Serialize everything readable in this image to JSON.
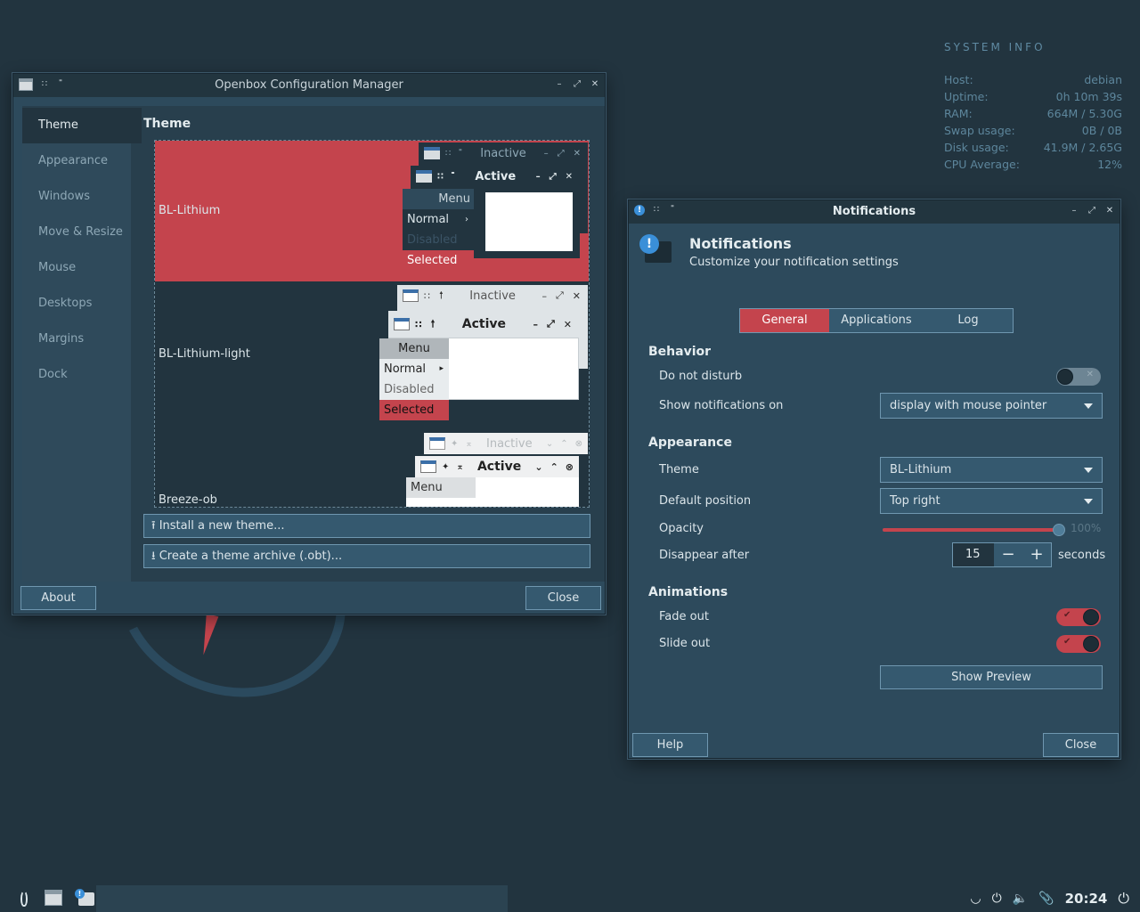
{
  "conky": {
    "title": "SYSTEM INFO",
    "rows": [
      {
        "label": "Host:",
        "value": "debian"
      },
      {
        "label": "Uptime:",
        "value": "0h 10m 39s"
      },
      {
        "label": "RAM:",
        "value": "664M / 5.30G"
      },
      {
        "label": "Swap usage:",
        "value": "0B / 0B"
      },
      {
        "label": "Disk usage:",
        "value": "41.9M / 2.65G"
      },
      {
        "label": "CPU Average:",
        "value": "12%"
      }
    ]
  },
  "obconf": {
    "title": "Openbox Configuration Manager",
    "sidebar": [
      "Theme",
      "Appearance",
      "Windows",
      "Move & Resize",
      "Mouse",
      "Desktops",
      "Margins",
      "Dock"
    ],
    "heading": "Theme",
    "themes": [
      "BL-Lithium",
      "BL-Lithium-light",
      "Breeze-ob"
    ],
    "preview": {
      "inactive": "Inactive",
      "active": "Active",
      "menu": "Menu",
      "normal": "Normal",
      "disabled": "Disabled",
      "selected": "Selected"
    },
    "install_label": "Install a new theme...",
    "archive_label": "Create a theme archive (.obt)...",
    "about_label": "About",
    "close_label": "Close"
  },
  "notif": {
    "title": "Notifications",
    "header_title": "Notifications",
    "header_subtitle": "Customize your notification settings",
    "tabs": [
      "General",
      "Applications",
      "Log"
    ],
    "behavior": "Behavior",
    "dnd": "Do not disturb",
    "show_on": "Show notifications on",
    "show_on_value": "display with mouse pointer",
    "appearance": "Appearance",
    "theme": "Theme",
    "theme_value": "BL-Lithium",
    "default_position": "Default position",
    "position_value": "Top right",
    "opacity": "Opacity",
    "opacity_value": "100%",
    "opacity_fraction": 1.0,
    "disappear_after": "Disappear after",
    "disappear_value": "15",
    "seconds": "seconds",
    "animations": "Animations",
    "fade_out": "Fade out",
    "slide_out": "Slide out",
    "show_preview": "Show Preview",
    "help": "Help",
    "close": "Close"
  },
  "taskbar": {
    "clock": "20:24"
  },
  "colors": {
    "accent": "#c4444d",
    "panel": "#2d4a5c",
    "button": "#35596f"
  }
}
